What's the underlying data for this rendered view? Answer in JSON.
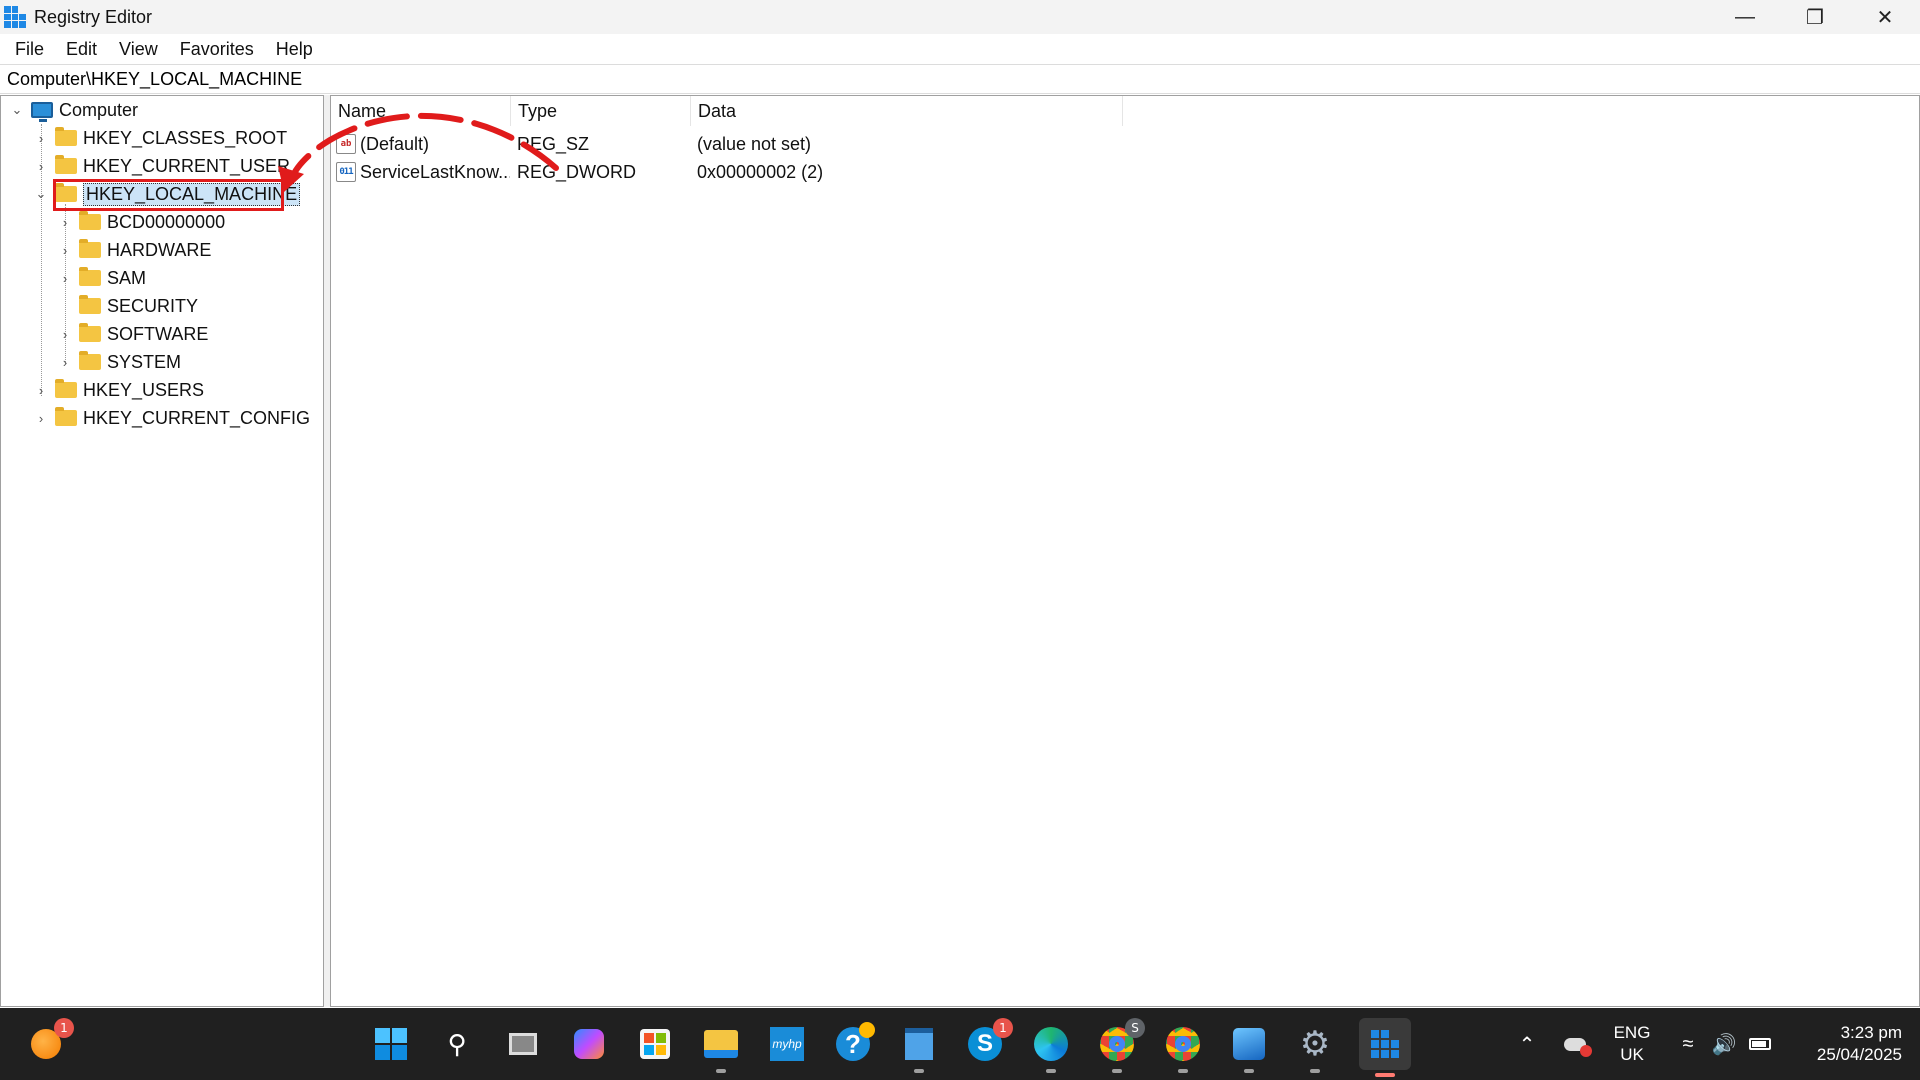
{
  "window": {
    "title": "Registry Editor",
    "minimize_glyph": "—",
    "restore_glyph": "❐",
    "close_glyph": "✕"
  },
  "menu": [
    "File",
    "Edit",
    "View",
    "Favorites",
    "Help"
  ],
  "address": "Computer\\HKEY_LOCAL_MACHINE",
  "tree": {
    "root": "Computer",
    "hives": {
      "classes_root": "HKEY_CLASSES_ROOT",
      "current_user": "HKEY_CURRENT_USER",
      "local_machine": "HKEY_LOCAL_MACHINE",
      "users": "HKEY_USERS",
      "current_config": "HKEY_CURRENT_CONFIG"
    },
    "local_machine_children": [
      "BCD00000000",
      "HARDWARE",
      "SAM",
      "SECURITY",
      "SOFTWARE",
      "SYSTEM"
    ],
    "selected": "HKEY_LOCAL_MACHINE"
  },
  "list": {
    "headers": {
      "name": "Name",
      "type": "Type",
      "data": "Data"
    },
    "rows": [
      {
        "name": "(Default)",
        "type": "REG_SZ",
        "data": "(value not set)",
        "icon": "string-value-icon"
      },
      {
        "name": "ServiceLastKnow...",
        "type": "REG_DWORD",
        "data": "0x00000002 (2)",
        "icon": "dword-value-icon"
      }
    ]
  },
  "annotation": {
    "color": "#e01b1b"
  },
  "taskbar": {
    "widget_badge": "1",
    "skype_badge": "1",
    "chrome_badge": "S",
    "language": "ENG",
    "region": "UK",
    "time": "3:23 pm",
    "date": "25/04/2025"
  }
}
